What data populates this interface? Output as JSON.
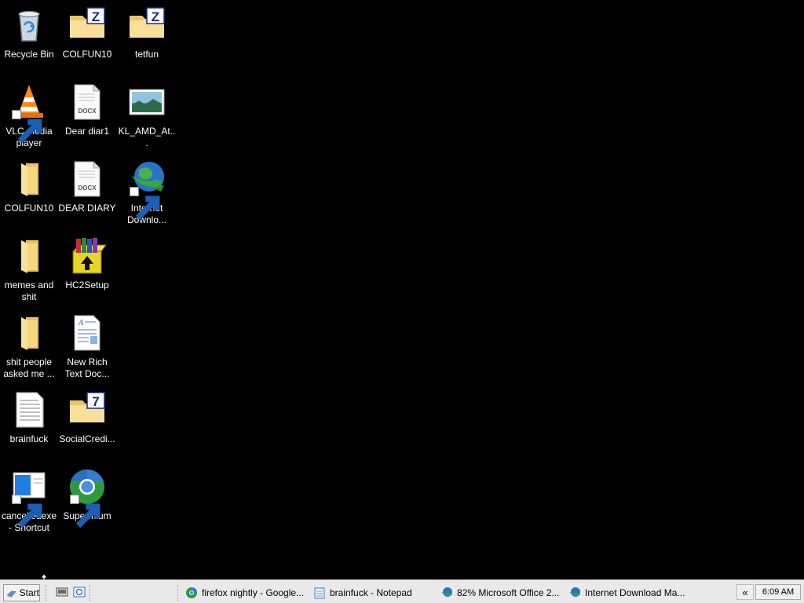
{
  "desktop": {
    "icons": [
      {
        "label": "Recycle Bin"
      },
      {
        "label": "COLFUN10"
      },
      {
        "label": "tetfun"
      },
      {
        "label": "VLC media player"
      },
      {
        "label": "Dear diar1"
      },
      {
        "label": "KL_AMD_At..."
      },
      {
        "label": "COLFUN10"
      },
      {
        "label": "DEAR DIARY"
      },
      {
        "label": "Internet Downlo..."
      },
      {
        "label": "memes and shit"
      },
      {
        "label": "HC2Setup"
      },
      {
        "label": "shit people asked me ..."
      },
      {
        "label": "New Rich Text Doc..."
      },
      {
        "label": "brainfuck"
      },
      {
        "label": "SocialCredi..."
      },
      {
        "label": "cancelledexe - Shortcut"
      },
      {
        "label": "Supermium"
      }
    ],
    "docx_tag": "DOCX",
    "archive_tag_z": "Z",
    "archive_tag_7": "7"
  },
  "taskbar": {
    "start_label": "Start",
    "tasks": [
      {
        "label": "firefox nightly - Google...",
        "icon": "chrome-icon"
      },
      {
        "label": "brainfuck - Notepad",
        "icon": "notepad-icon"
      },
      {
        "label": "82% Microsoft Office 2...",
        "icon": "idm-icon"
      },
      {
        "label": "Internet Download Ma...",
        "icon": "idm-icon"
      }
    ],
    "tray_chevron": "«",
    "clock": "6:09 AM"
  }
}
